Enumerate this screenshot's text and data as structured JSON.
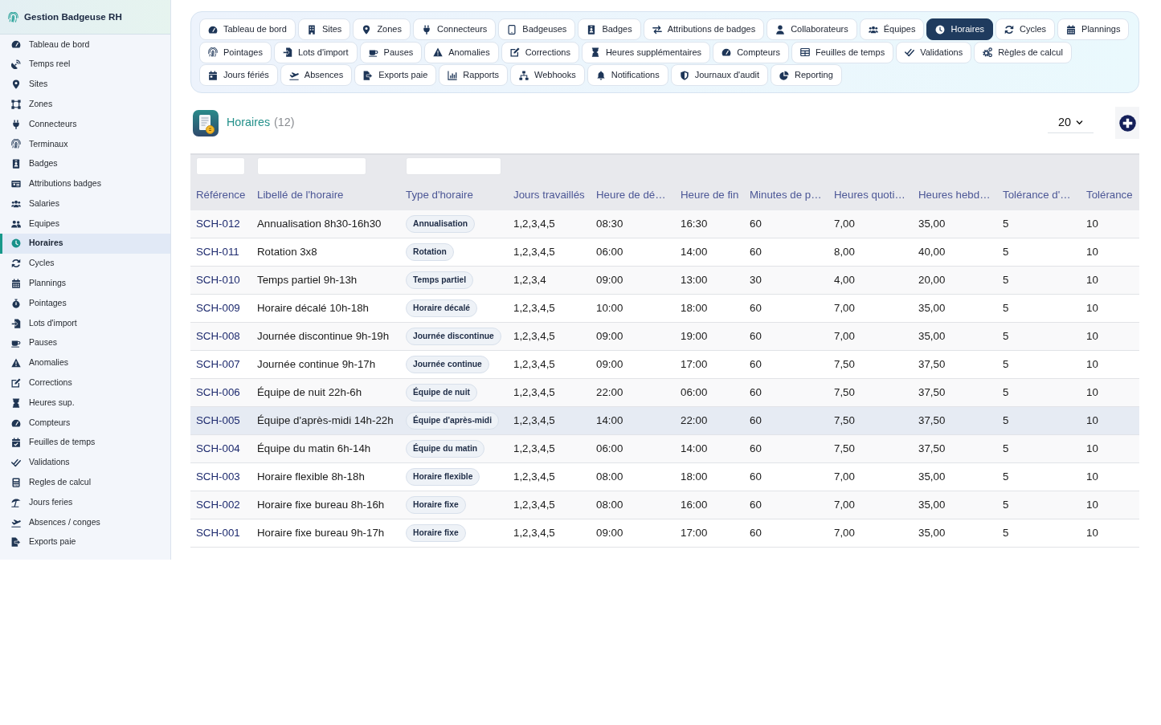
{
  "sidebar": {
    "title": "Gestion Badgeuse RH",
    "items": [
      {
        "label": "Tableau de bord",
        "selected": false
      },
      {
        "label": "Temps reel",
        "selected": false
      },
      {
        "label": "Sites",
        "selected": false
      },
      {
        "label": "Zones",
        "selected": false
      },
      {
        "label": "Connecteurs",
        "selected": false
      },
      {
        "label": "Terminaux",
        "selected": false
      },
      {
        "label": "Badges",
        "selected": false
      },
      {
        "label": "Attributions badges",
        "selected": false
      },
      {
        "label": "Salaries",
        "selected": false
      },
      {
        "label": "Equipes",
        "selected": false
      },
      {
        "label": "Horaires",
        "selected": true
      },
      {
        "label": "Cycles",
        "selected": false
      },
      {
        "label": "Plannings",
        "selected": false
      },
      {
        "label": "Pointages",
        "selected": false
      },
      {
        "label": "Lots d'import",
        "selected": false
      },
      {
        "label": "Pauses",
        "selected": false
      },
      {
        "label": "Anomalies",
        "selected": false
      },
      {
        "label": "Corrections",
        "selected": false
      },
      {
        "label": "Heures sup.",
        "selected": false
      },
      {
        "label": "Compteurs",
        "selected": false
      },
      {
        "label": "Feuilles de temps",
        "selected": false
      },
      {
        "label": "Validations",
        "selected": false
      },
      {
        "label": "Regles de calcul",
        "selected": false
      },
      {
        "label": "Jours feries",
        "selected": false
      },
      {
        "label": "Absences / conges",
        "selected": false
      },
      {
        "label": "Exports paie",
        "selected": false
      }
    ]
  },
  "tab_rows": [
    {
      "tabs": [
        {
          "label": "Tableau de bord",
          "selected": false
        },
        {
          "label": "Sites",
          "selected": false
        },
        {
          "label": "Zones",
          "selected": false
        },
        {
          "label": "Connecteurs",
          "selected": false
        },
        {
          "label": "Badgeuses",
          "selected": false
        },
        {
          "label": "Badges",
          "selected": false
        },
        {
          "label": "Attributions de badges",
          "selected": false
        },
        {
          "label": "Collaborateurs",
          "selected": false
        },
        {
          "label": "Équipes",
          "selected": false
        },
        {
          "label": "Horaires",
          "selected": true
        },
        {
          "label": "Cycles",
          "selected": false
        },
        {
          "label": "Plannings",
          "selected": false
        }
      ]
    },
    {
      "tabs": [
        {
          "label": "Pointages",
          "selected": false
        },
        {
          "label": "Lots d'import",
          "selected": false
        },
        {
          "label": "Pauses",
          "selected": false
        },
        {
          "label": "Anomalies",
          "selected": false
        },
        {
          "label": "Corrections",
          "selected": false
        },
        {
          "label": "Heures supplémentaires",
          "selected": false
        },
        {
          "label": "Compteurs",
          "selected": false
        },
        {
          "label": "Feuilles de temps",
          "selected": false
        },
        {
          "label": "Validations",
          "selected": false
        },
        {
          "label": "Règles de calcul",
          "selected": false
        }
      ]
    },
    {
      "tabs": [
        {
          "label": "Jours fériés",
          "selected": false
        },
        {
          "label": "Absences",
          "selected": false
        },
        {
          "label": "Exports paie",
          "selected": false
        },
        {
          "label": "Rapports",
          "selected": false
        },
        {
          "label": "Webhooks",
          "selected": false
        },
        {
          "label": "Notifications",
          "selected": false
        },
        {
          "label": "Journaux d'audit",
          "selected": false
        },
        {
          "label": "Reporting",
          "selected": false
        }
      ]
    }
  ],
  "page_header": {
    "title": "Horaires",
    "count": "(12)",
    "page_size": "20"
  },
  "table": {
    "columns": [
      {
        "label": "Référence",
        "kind": "link",
        "filter": true
      },
      {
        "label": "Libellé de l'horaire",
        "kind": "text",
        "filter": true
      },
      {
        "label": "Type d'horaire",
        "kind": "tag",
        "filter": true
      },
      {
        "label": "Jours travaillés",
        "kind": "text",
        "filter": false
      },
      {
        "label": "Heure de dé…",
        "kind": "text",
        "filter": false
      },
      {
        "label": "Heure de fin",
        "kind": "text",
        "filter": false
      },
      {
        "label": "Minutes de p…",
        "kind": "text",
        "filter": false
      },
      {
        "label": "Heures quoti…",
        "kind": "text",
        "filter": false
      },
      {
        "label": "Heures hebd…",
        "kind": "text",
        "filter": false
      },
      {
        "label": "Tolérance d'…",
        "kind": "text",
        "filter": false
      },
      {
        "label": "Tolérance",
        "kind": "text",
        "filter": false
      }
    ],
    "rows": [
      {
        "selected": false,
        "cells": [
          "SCH-012",
          "Annualisation 8h30-16h30",
          "Annualisation",
          "1,2,3,4,5",
          "08:30",
          "16:30",
          "60",
          "7,00",
          "35,00",
          "5",
          "10"
        ]
      },
      {
        "selected": false,
        "cells": [
          "SCH-011",
          "Rotation 3x8",
          "Rotation",
          "1,2,3,4,5",
          "06:00",
          "14:00",
          "60",
          "8,00",
          "40,00",
          "5",
          "10"
        ]
      },
      {
        "selected": false,
        "cells": [
          "SCH-010",
          "Temps partiel 9h-13h",
          "Temps partiel",
          "1,2,3,4",
          "09:00",
          "13:00",
          "30",
          "4,00",
          "20,00",
          "5",
          "10"
        ]
      },
      {
        "selected": false,
        "cells": [
          "SCH-009",
          "Horaire décalé 10h-18h",
          "Horaire décalé",
          "1,2,3,4,5",
          "10:00",
          "18:00",
          "60",
          "7,00",
          "35,00",
          "5",
          "10"
        ]
      },
      {
        "selected": false,
        "cells": [
          "SCH-008",
          "Journée discontinue 9h-19h",
          "Journée discontinue",
          "1,2,3,4,5",
          "09:00",
          "19:00",
          "60",
          "7,00",
          "35,00",
          "5",
          "10"
        ]
      },
      {
        "selected": false,
        "cells": [
          "SCH-007",
          "Journée continue 9h-17h",
          "Journée continue",
          "1,2,3,4,5",
          "09:00",
          "17:00",
          "60",
          "7,50",
          "37,50",
          "5",
          "10"
        ]
      },
      {
        "selected": false,
        "cells": [
          "SCH-006",
          "Équipe de nuit 22h-6h",
          "Équipe de nuit",
          "1,2,3,4,5",
          "22:00",
          "06:00",
          "60",
          "7,50",
          "37,50",
          "5",
          "10"
        ]
      },
      {
        "selected": true,
        "cells": [
          "SCH-005",
          "Équipe d'après-midi 14h-22h",
          "Équipe d'après-midi",
          "1,2,3,4,5",
          "14:00",
          "22:00",
          "60",
          "7,50",
          "37,50",
          "5",
          "10"
        ]
      },
      {
        "selected": false,
        "cells": [
          "SCH-004",
          "Équipe du matin 6h-14h",
          "Équipe du matin",
          "1,2,3,4,5",
          "06:00",
          "14:00",
          "60",
          "7,50",
          "37,50",
          "5",
          "10"
        ]
      },
      {
        "selected": false,
        "cells": [
          "SCH-003",
          "Horaire flexible 8h-18h",
          "Horaire flexible",
          "1,2,3,4,5",
          "08:00",
          "18:00",
          "60",
          "7,00",
          "35,00",
          "5",
          "10"
        ]
      },
      {
        "selected": false,
        "cells": [
          "SCH-002",
          "Horaire fixe bureau 8h-16h",
          "Horaire fixe",
          "1,2,3,4,5",
          "08:00",
          "16:00",
          "60",
          "7,00",
          "35,00",
          "5",
          "10"
        ]
      },
      {
        "selected": false,
        "cells": [
          "SCH-001",
          "Horaire fixe bureau 9h-17h",
          "Horaire fixe",
          "1,2,3,4,5",
          "09:00",
          "17:00",
          "60",
          "7,00",
          "35,00",
          "5",
          "10"
        ]
      }
    ]
  }
}
